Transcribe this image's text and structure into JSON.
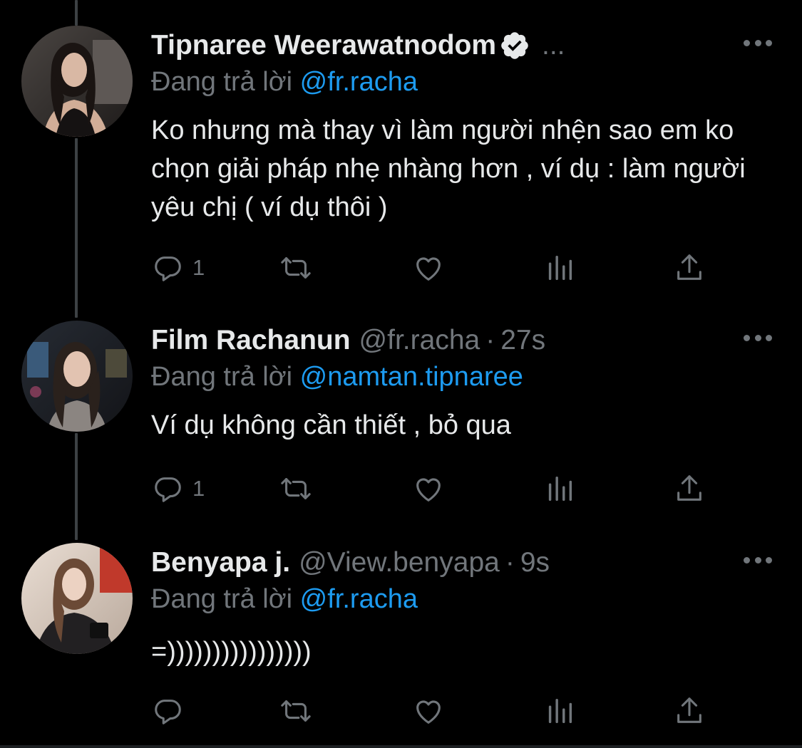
{
  "colors": {
    "background": "#000000",
    "primary_text": "#e7e9ea",
    "secondary_text": "#71767b",
    "mention": "#1d9bf0",
    "thread_line": "#3d4144"
  },
  "tweets": [
    {
      "name": "Tipnaree Weerawatnodom",
      "verified": true,
      "truncation": "...",
      "replying_prefix": "Đang trả lời ",
      "replying_to": "@fr.racha",
      "text": "Ko nhưng mà thay vì làm người nhện sao em ko chọn giải pháp nhẹ nhàng hơn , ví dụ : làm người yêu chị ( ví dụ thôi )",
      "reply_count": "1",
      "avatar_icon": "profile-photo"
    },
    {
      "name": "Film Rachanun",
      "handle": "@fr.racha",
      "separator": "·",
      "time": "27s",
      "replying_prefix": "Đang trả lời ",
      "replying_to": "@namtan.tipnaree",
      "text": "Ví dụ không cần thiết , bỏ qua",
      "reply_count": "1",
      "avatar_icon": "profile-photo"
    },
    {
      "name": "Benyapa j.",
      "handle": "@View.benyapa",
      "separator": "·",
      "time": "9s",
      "replying_prefix": "Đang trả lời ",
      "replying_to": "@fr.racha",
      "text": "=))))))))))))))))",
      "reply_count": "",
      "avatar_icon": "profile-photo"
    }
  ],
  "action_icons": [
    "reply-icon",
    "retweet-icon",
    "like-icon",
    "views-icon",
    "share-icon"
  ]
}
